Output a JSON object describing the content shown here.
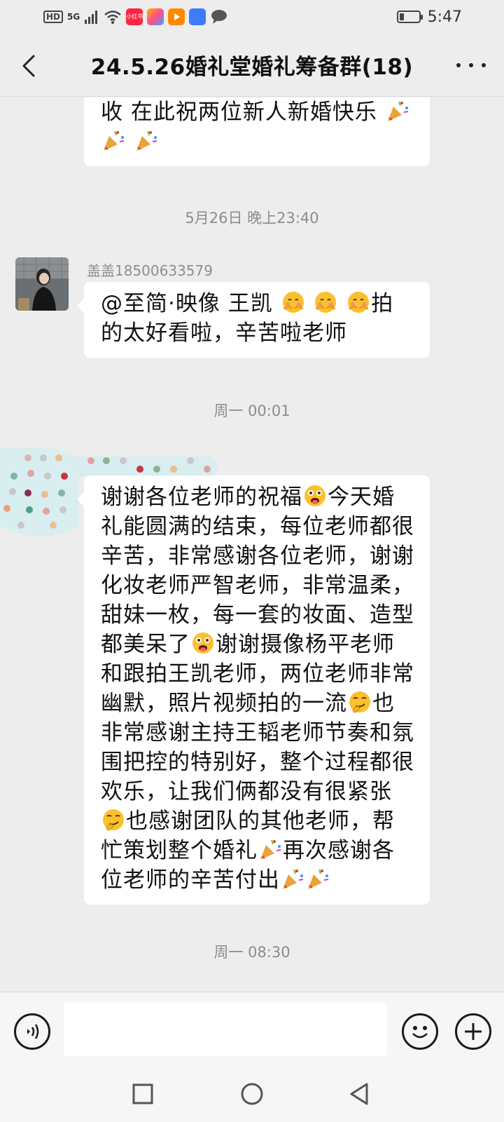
{
  "status_bar": {
    "hd": "HD",
    "network": "5G",
    "app_badge_label": "小红书",
    "time": "5:47"
  },
  "header": {
    "title": "24.5.26婚礼堂婚礼筹备群(18)"
  },
  "messages": [
    {
      "segments": [
        "收  在此祝两位新人新婚快乐",
        "party-popper",
        "party-popper",
        "party-popper"
      ]
    },
    {
      "timestamp": "5月26日 晚上23:40"
    },
    {
      "sender": "盖盖18500633579",
      "text_a": "@至简·映像  王凯  ",
      "text_b": "拍的太好看啦，辛苦啦老师"
    },
    {
      "timestamp": "周一 00:01"
    },
    {
      "p1": "谢谢各位老师的祝福",
      "p2": "今天婚礼能圆满的结束，每位老师都很辛苦，非常感谢各位老师，谢谢化妆老师严智老师，非常温柔，甜妹一枚，每一套的妆面、造型都美呆了",
      "p3": "谢谢摄像杨平老师和跟拍王凯老师，两位老师非常幽默，照片视频拍的一流",
      "p4": "也非常感谢主持王韬老师节奏和氛围把控的特别好，整个过程都很欢乐，让我们俩都没有很紧张",
      "p5": "也感谢团队的其他老师，帮忙策划整个婚礼",
      "p6": "再次感谢各位老师的辛苦付出"
    },
    {
      "timestamp": "周一 08:30"
    }
  ],
  "input": {
    "placeholder": ""
  },
  "colors": {
    "background": "#ededed",
    "bubble": "#ffffff",
    "timestamp": "#8c8c8c"
  }
}
